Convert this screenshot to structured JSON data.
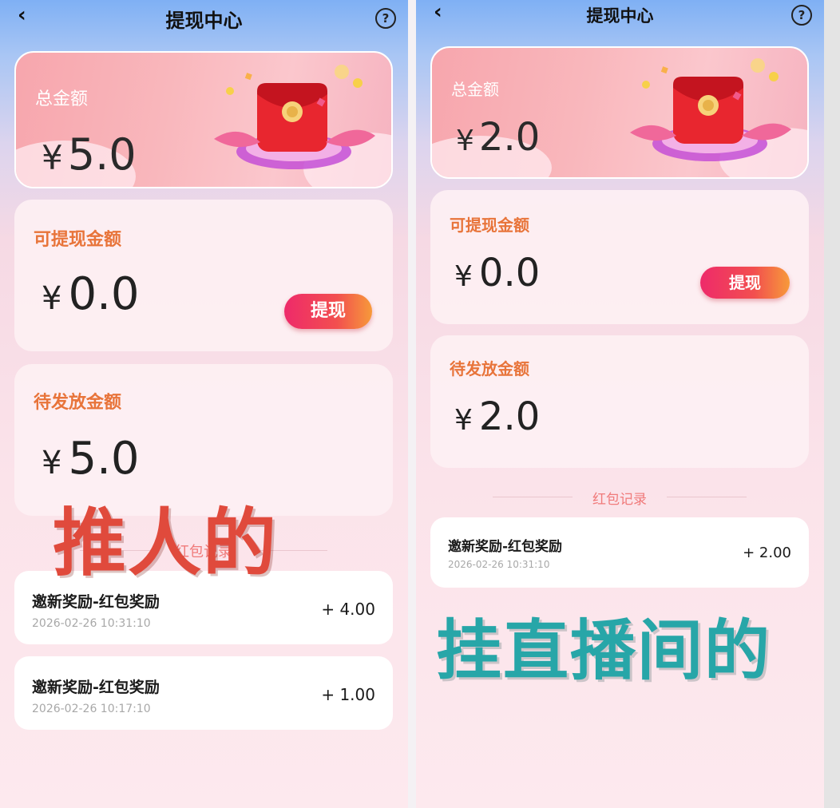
{
  "left": {
    "nav": {
      "back": "‹",
      "title": "提现中心",
      "help": "?"
    },
    "total": {
      "label": "总金额",
      "yen": "¥",
      "value": "5.0"
    },
    "withdrawable": {
      "label": "可提现金额",
      "yen": "¥",
      "value": "0.0",
      "button": "提现"
    },
    "pending": {
      "label": "待发放金额",
      "yen": "¥",
      "value": "5.0"
    },
    "records_title": "红包记录",
    "records": [
      {
        "name": "邀新奖励-红包奖励",
        "time": "2026-02-26 10:31:10",
        "amount": "+ 4.00"
      },
      {
        "name": "邀新奖励-红包奖励",
        "time": "2026-02-26 10:17:10",
        "amount": "+ 1.00"
      }
    ],
    "overlay_text": "推人的"
  },
  "right": {
    "nav": {
      "back": "‹",
      "title": "提现中心",
      "help": "?"
    },
    "total": {
      "label": "总金额",
      "yen": "¥",
      "value": "2.0"
    },
    "withdrawable": {
      "label": "可提现金额",
      "yen": "¥",
      "value": "0.0",
      "button": "提现"
    },
    "pending": {
      "label": "待发放金额",
      "yen": "¥",
      "value": "2.0"
    },
    "records_title": "红包记录",
    "records": [
      {
        "name": "邀新奖励-红包奖励",
        "time": "2026-02-26 10:31:10",
        "amount": "+ 2.00"
      }
    ],
    "overlay_text": "挂直播间的"
  },
  "colors": {
    "accent_orange": "#e8743a",
    "button_gradient_start": "#ee2a6a",
    "button_gradient_end": "#f79a3a",
    "overlay_left": "#e04a3c",
    "overlay_right": "#27a6a8"
  }
}
